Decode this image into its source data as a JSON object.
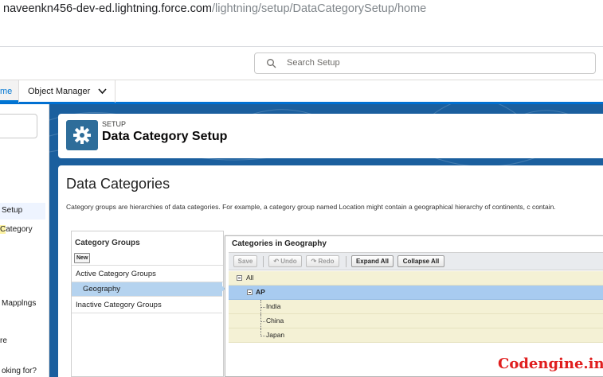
{
  "browser": {
    "url_host": "naveenkn456-dev-ed.lightning.force.com",
    "url_path": "/lightning/setup/DataCategorySetup/home"
  },
  "header": {
    "search_placeholder": "Search Setup"
  },
  "nav": {
    "home_tab": "me",
    "object_manager_tab": "Object Manager"
  },
  "sidebar": {
    "items": [
      {
        "label": "Setup"
      },
      {
        "label_pre": "",
        "label_highlight": "C",
        "label_post": "ategory"
      },
      {
        "label": "Mapplngs"
      },
      {
        "label": "re"
      },
      {
        "label": "oking for?"
      }
    ]
  },
  "page_header": {
    "kicker": "SETUP",
    "title": "Data Category Setup"
  },
  "main": {
    "title": "Data Categories",
    "description": "Category groups are hierarchies of data categories. For example, a category group named Location might contain a geographical hierarchy of continents, c contain."
  },
  "category_groups": {
    "title": "Category Groups",
    "new_button": "New",
    "active_label": "Active Category Groups",
    "active_items": [
      "Geography"
    ],
    "inactive_label": "Inactive Category Groups"
  },
  "categories": {
    "title": "Categories in Geography",
    "toolbar": {
      "save": "Save",
      "undo": "Undo",
      "redo": "Redo",
      "expand_all": "Expand All",
      "collapse_all": "Collapse All"
    },
    "tree": {
      "root": "All",
      "selected": "AP",
      "children": [
        "India",
        "China",
        "Japan"
      ]
    }
  },
  "watermark": "Codengine.in",
  "colors": {
    "brand_blue": "#0176d3",
    "band_blue": "#1b5f9e",
    "setup_icon_bg": "#2e6d9a",
    "tree_row_bg": "#f4f1d5",
    "tree_selected_bg": "#a8cbf0",
    "watermark_red": "#e01e1e"
  }
}
